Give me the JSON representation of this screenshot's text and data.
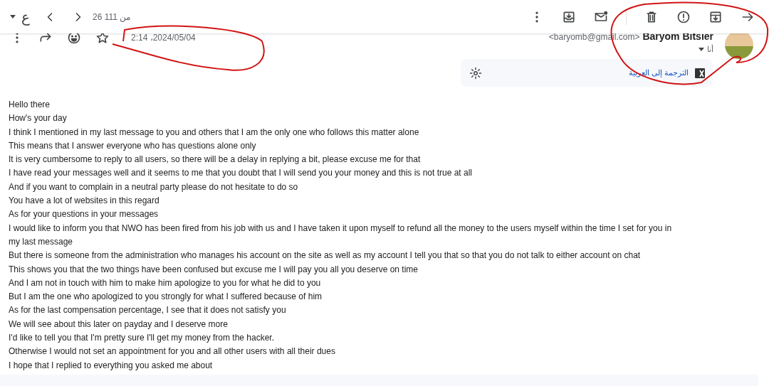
{
  "toolbar": {
    "input_tool": "ع",
    "count": "26 من 111"
  },
  "message": {
    "sender_name": "Baryom Bitsier",
    "sender_email": "<baryomb@gmail.com>",
    "recipient": "أنا",
    "date": "2:14 ،2024/05/04"
  },
  "translate_bar": {
    "link": "الترجمة إلى العربية"
  },
  "body": [
    "Hello there",
    "How's your day",
    "I think I mentioned in my last message to you and others that I am the only one who follows this matter alone",
    "This means that I answer everyone who has questions alone only",
    "It is very cumbersome to reply to all users, so there will be a delay in replying a bit, please excuse me for that",
    "I have read your messages well and it seems to me that you doubt that I will send you your money and this is not true at all",
    "And if you want to complain in a neutral party please do not hesitate to do so",
    "You have a lot of websites in this regard",
    "As for your questions in your messages",
    "I would like to inform you that NWO  has been fired from his job with us and I have taken it upon myself to refund all the money to the users myself within the time I set for you in my last message",
    "But there is someone from the administration who manages his account on the site as well as my account I tell you that so that you do not talk to either account on chat",
    "This shows you that the two things have been confused but excuse me I will pay you all you deserve on time",
    "And I am not in touch with him to make him apologize to you for what he did to you",
    "But I am the one who apologized to you strongly for what I suffered because of him",
    "As for the last compensation percentage, I see that it does not satisfy you",
    "We will see about this later on payday and I deserve more",
    "I'd like to tell you that I'm pretty sure I'll get my money from the hacker.",
    "Otherwise I would not set an appointment for you and all other users with all their dues",
    "I hope that I replied to everything you asked me about"
  ]
}
